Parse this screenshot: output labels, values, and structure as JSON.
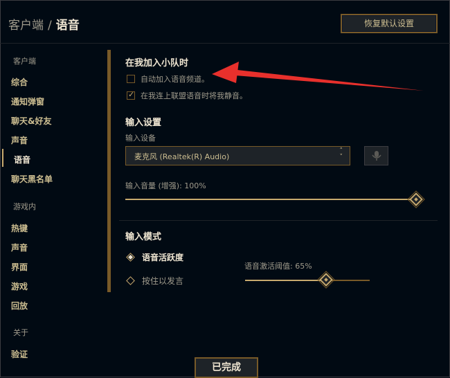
{
  "header": {
    "breadcrumb_parent": "客户端",
    "breadcrumb_sep": "/",
    "breadcrumb_current": "语音",
    "reset_label": "恢复默认设置"
  },
  "sidebar": {
    "client_section": "客户端",
    "client_items": [
      "综合",
      "通知弹窗",
      "聊天&好友",
      "声音",
      "语音",
      "聊天黑名单"
    ],
    "ingame_section": "游戏内",
    "ingame_items": [
      "热键",
      "声音",
      "界面",
      "游戏",
      "回放"
    ],
    "about_section": "关于",
    "about_items": [
      "验证"
    ],
    "active_item": "语音"
  },
  "party": {
    "title": "在我加入小队时",
    "options": [
      {
        "label": "自动加入语音频道。",
        "checked": false
      },
      {
        "label": "在我连上联盟语音时将我静音。",
        "checked": true
      }
    ]
  },
  "input_settings": {
    "title": "输入设置",
    "device_label": "输入设备",
    "device_value": "麦克风 (Realtek(R) Audio)",
    "volume_label": "输入音量 (增强): 100%",
    "volume_level": 1.0
  },
  "input_mode": {
    "title": "输入模式",
    "options": [
      {
        "label": "语音活跃度",
        "selected": true
      },
      {
        "label": "按住以发言",
        "selected": false
      }
    ],
    "threshold_label": "语音激活阈值: 65%",
    "threshold_level": 0.65
  },
  "footer": {
    "done_label": "已完成"
  },
  "colors": {
    "background": "#010a13",
    "gold": "#c8aa6e",
    "gold_dark": "#785a28",
    "text_light": "#f0e6d2",
    "text_muted": "#a09b8c",
    "arrow_red": "#e8302c"
  }
}
